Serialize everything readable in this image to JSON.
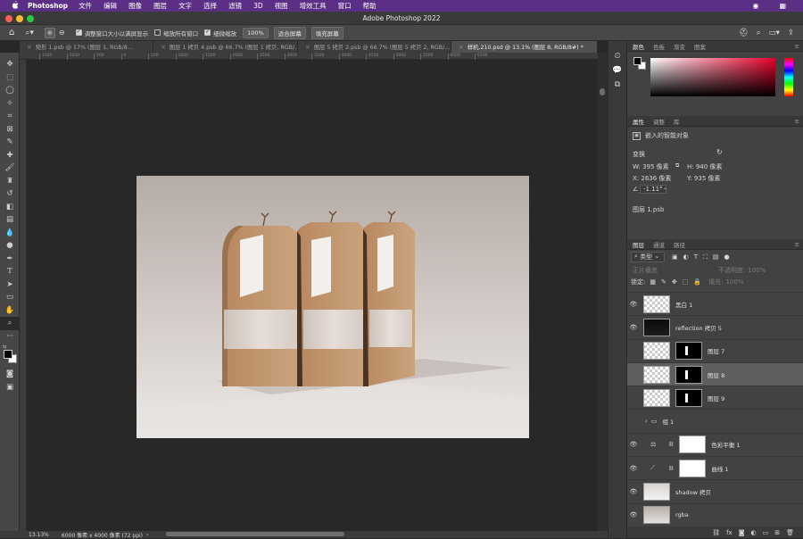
{
  "menubar": {
    "apple": "",
    "app": "Photoshop",
    "items": [
      "文件",
      "编辑",
      "图像",
      "图层",
      "文字",
      "选择",
      "滤镜",
      "3D",
      "视图",
      "增效工具",
      "窗口",
      "帮助"
    ]
  },
  "titlebar": {
    "title": "Adobe Photoshop 2022"
  },
  "options": {
    "zoom_fit_label": "调整窗口大小以满屏显示",
    "zoom_all_label": "缩放所有窗口",
    "scrubby_label": "细微缩放",
    "zoom_value": "100%",
    "fit_screen": "适合屏幕",
    "fill_screen": "填充屏幕"
  },
  "tabs": [
    {
      "label": "矩形 1.psb @ 17% (图层 1, RGB/8...",
      "active": false
    },
    {
      "label": "图层 1 拷贝 4.psb @ 66.7% (图层 1 拷贝, RGB/...",
      "active": false
    },
    {
      "label": "图层 5 拷贝 2.psb @ 66.7% (图层 5 拷贝 2, RGB/...",
      "active": false
    },
    {
      "label": "样机.210.psd @ 13.1% (图层 8, RGB/8#) *",
      "active": true
    }
  ],
  "ruler": [
    "1500",
    "1000",
    "500",
    "0",
    "500",
    "1000",
    "1500",
    "2000",
    "2500",
    "3000",
    "3500",
    "4000",
    "4500",
    "5000",
    "5500",
    "6000",
    "6500"
  ],
  "status": {
    "zoom": "13.13%",
    "doc": "6000 像素 x 4000 像素 (72 ppi)"
  },
  "color_panel": {
    "tabs": [
      "颜色",
      "色板",
      "渐变",
      "图案"
    ],
    "hue_color": "#e8002a"
  },
  "properties": {
    "tabs": [
      "属性",
      "调整",
      "库"
    ],
    "type": "嵌入的智能对象",
    "transform": "变换",
    "w": "W:  395 像素",
    "h": "H:  940 像素",
    "x": "X:  2636 像素",
    "y": "Y:  935 像素",
    "angle": "-1.11°",
    "file": "图层 1.psb"
  },
  "layers_panel": {
    "tabs": [
      "图层",
      "通道",
      "路径"
    ],
    "filter": "类型",
    "blend": "正片叠底",
    "opacity_label": "不透明度:",
    "opacity": "100%",
    "lock_label": "锁定:",
    "fill_label": "填充:",
    "fill": "100%",
    "layers": [
      {
        "name": "黑白 1",
        "eye": true,
        "thumb": "checker",
        "mask": false
      },
      {
        "name": "reflection 拷贝 5",
        "eye": true,
        "thumb": "dark",
        "mask": false
      },
      {
        "name": "图层 7",
        "eye": false,
        "thumb": "checker",
        "mask": true
      },
      {
        "name": "图层 8",
        "eye": false,
        "thumb": "checker",
        "mask": true,
        "selected": true
      },
      {
        "name": "图层 9",
        "eye": false,
        "thumb": "checker",
        "mask": true
      },
      {
        "name": "组 1",
        "eye": false,
        "thumb": "folder",
        "mask": false
      },
      {
        "name": "色彩平衡 1",
        "eye": true,
        "thumb": "adjust",
        "mask": true
      },
      {
        "name": "曲线 1",
        "eye": true,
        "thumb": "curve",
        "mask": true
      },
      {
        "name": "shadow 拷贝",
        "eye": true,
        "thumb": "photo",
        "mask": false
      },
      {
        "name": "rgba",
        "eye": true,
        "thumb": "photo2",
        "mask": false
      }
    ]
  }
}
